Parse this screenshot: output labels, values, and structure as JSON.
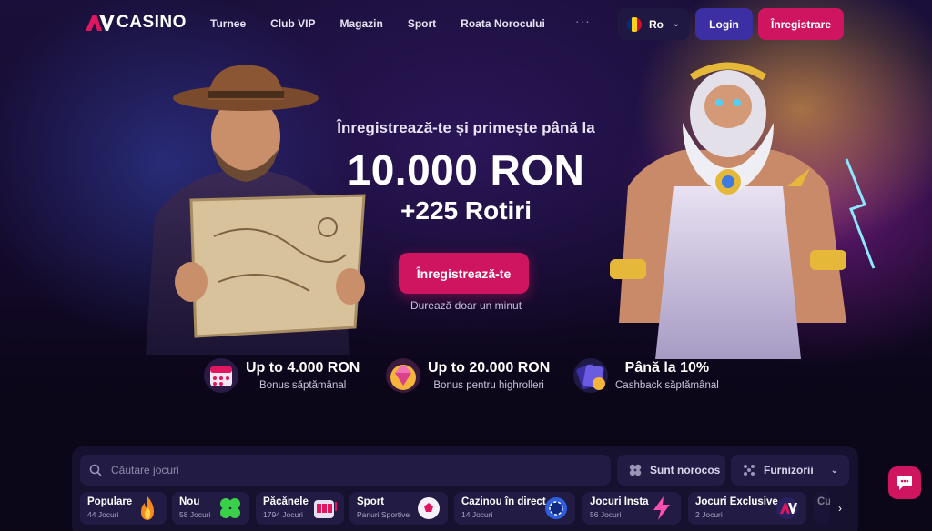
{
  "brand": {
    "logo_text": "CASINO"
  },
  "nav": {
    "items": [
      "Turnee",
      "Club VIP",
      "Magazin",
      "Sport",
      "Roata Norocului"
    ],
    "more": "···"
  },
  "header": {
    "language": "Ro",
    "login_label": "Login",
    "register_label": "Înregistrare"
  },
  "hero": {
    "subtitle": "Înregistrează-te și primește până la",
    "amount": "10.000 RON",
    "spins": "+225 Rotiri",
    "cta_label": "Înregistrează-te",
    "note": "Durează doar un minut"
  },
  "features": [
    {
      "title": "Up to 4.000 RON",
      "desc": "Bonus săptămânal",
      "icon": "calendar-gift-icon"
    },
    {
      "title": "Up to 20.000 RON",
      "desc": "Bonus pentru highrolleri",
      "icon": "diamond-icon"
    },
    {
      "title": "Până la 10%",
      "desc": "Cashback săptămânal",
      "icon": "cashback-icon"
    }
  ],
  "games": {
    "search_placeholder": "Căutare jocuri",
    "lucky_label": "Sunt norocos",
    "providers_label": "Furnizorii",
    "categories": [
      {
        "name": "Populare",
        "count": "44 Jocuri",
        "icon": "fire-icon"
      },
      {
        "name": "Nou",
        "count": "58 Jocuri",
        "icon": "clover-icon"
      },
      {
        "name": "Păcănele",
        "count": "1794 Jocuri",
        "icon": "slot-machine-icon"
      },
      {
        "name": "Sport",
        "count": "Pariuri Sportive",
        "icon": "soccer-ball-icon"
      },
      {
        "name": "Cazinou în direct",
        "count": "14 Jocuri",
        "icon": "chip-icon"
      },
      {
        "name": "Jocuri Insta",
        "count": "56 Jocuri",
        "icon": "lightning-icon"
      },
      {
        "name": "Jocuri Exclusive",
        "count": "2 Jocuri",
        "icon": "av-logo-icon"
      },
      {
        "name": "Cu",
        "count": "",
        "icon": ""
      }
    ]
  },
  "colors": {
    "accent": "#d01560",
    "login": "#3b2fa3",
    "panel": "#15112e",
    "control": "#221c45"
  }
}
